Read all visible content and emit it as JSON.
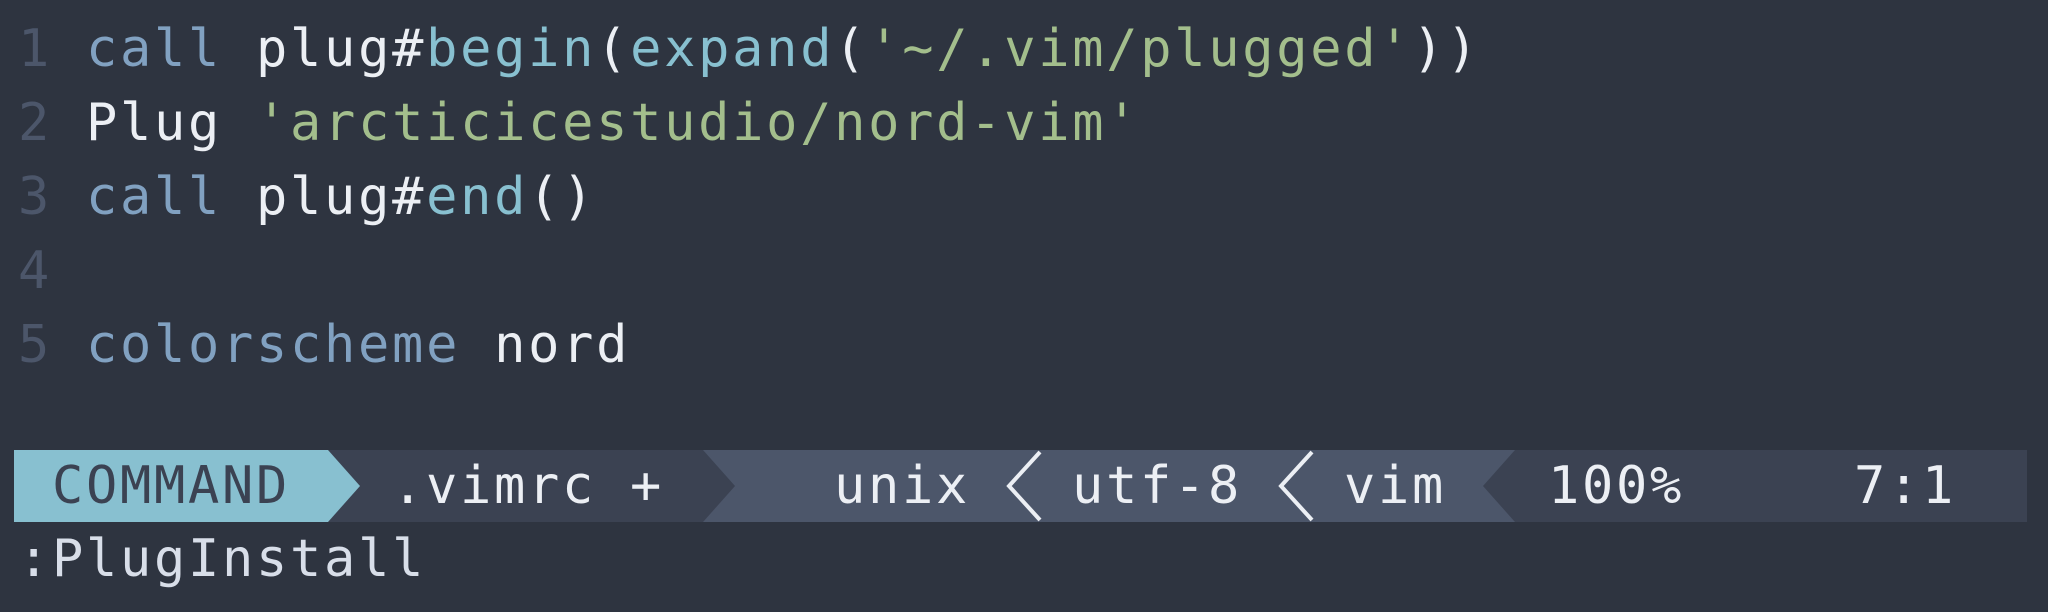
{
  "editor": {
    "lines": [
      {
        "number": "1",
        "tokens": [
          {
            "text": "call",
            "kind": "keyword"
          },
          {
            "text": " ",
            "kind": "plain"
          },
          {
            "text": "plug#",
            "kind": "plain"
          },
          {
            "text": "begin",
            "kind": "function"
          },
          {
            "text": "(",
            "kind": "plain"
          },
          {
            "text": "expand",
            "kind": "function"
          },
          {
            "text": "(",
            "kind": "plain"
          },
          {
            "text": "'~/.vim/plugged'",
            "kind": "string"
          },
          {
            "text": "))",
            "kind": "plain"
          }
        ]
      },
      {
        "number": "2",
        "tokens": [
          {
            "text": "Plug",
            "kind": "plain"
          },
          {
            "text": " ",
            "kind": "plain"
          },
          {
            "text": "'arcticicestudio/nord-vim'",
            "kind": "string"
          }
        ]
      },
      {
        "number": "3",
        "tokens": [
          {
            "text": "call",
            "kind": "keyword"
          },
          {
            "text": " ",
            "kind": "plain"
          },
          {
            "text": "plug#",
            "kind": "plain"
          },
          {
            "text": "end",
            "kind": "function"
          },
          {
            "text": "()",
            "kind": "plain"
          }
        ]
      },
      {
        "number": "4",
        "tokens": []
      },
      {
        "number": "5",
        "tokens": [
          {
            "text": "colorscheme",
            "kind": "keyword"
          },
          {
            "text": " ",
            "kind": "plain"
          },
          {
            "text": "nord",
            "kind": "plain"
          }
        ]
      }
    ]
  },
  "statusline": {
    "mode": "COMMAND",
    "filename": ".vimrc +",
    "fileformat": "unix",
    "encoding": "utf-8",
    "filetype": "vim",
    "percent": "100%",
    "position": "7:1",
    "separator_icon": "thin-left-chevron"
  },
  "commandline": {
    "text": ":PlugInstall"
  },
  "colors": {
    "background": "#2E3440",
    "line_number": "#4C566A",
    "keyword": "#81A1C1",
    "function": "#88C0D0",
    "string": "#A3BE8C",
    "plain": "#ECEFF4",
    "mode_bg": "#88C0D0",
    "mode_fg": "#3B4252",
    "statusbar_dark": "#3B4252",
    "statusbar_light": "#4C566A"
  }
}
